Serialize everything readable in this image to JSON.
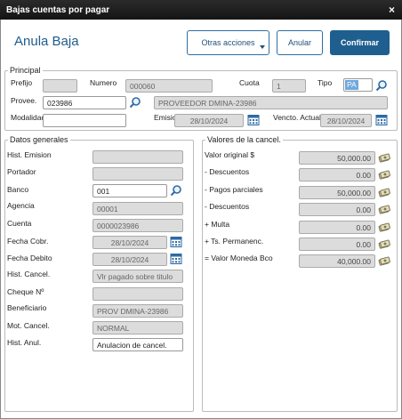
{
  "window": {
    "title": "Bajas cuentas por pagar",
    "close": "×"
  },
  "header": {
    "page_title": "Anula Baja",
    "btn_otras": "Otras acciones",
    "btn_anular": "Anular",
    "btn_confirmar": "Confirmar"
  },
  "principal": {
    "legend": "Principal",
    "prefijo_label": "Prefijo",
    "prefijo_value": "",
    "numero_label": "Numero",
    "numero_value": "000060",
    "cuota_label": "Cuota",
    "cuota_value": "1",
    "tipo_label": "Tipo",
    "tipo_value": "PA",
    "proveedor_label": "Provee.",
    "proveedor_code": "023986",
    "proveedor_name": "PROVEEDOR DMINA-23986",
    "modalidad_label": "Modalidad",
    "modalidad_value": "",
    "emision_label": "Emision",
    "emision_value": "28/10/2024",
    "vencto_label": "Vencto. Actual",
    "vencto_value": "28/10/2024"
  },
  "datos": {
    "legend": "Datos generales",
    "hist_emision_label": "Hist. Emision",
    "hist_emision_value": "",
    "portador_label": "Portador",
    "portador_value": "",
    "banco_label": "Banco",
    "banco_value": "001",
    "agencia_label": "Agencia",
    "agencia_value": "00001",
    "cuenta_label": "Cuenta",
    "cuenta_value": "0000023986",
    "fecha_cobr_label": "Fecha Cobr.",
    "fecha_cobr_value": "28/10/2024",
    "fecha_debito_label": "Fecha Debito",
    "fecha_debito_value": "28/10/2024",
    "hist_cancel_label": "Hist. Cancel.",
    "hist_cancel_value": "Vlr pagado sobre titulo",
    "cheque_label": "Cheque Nº",
    "cheque_value": "",
    "beneficiario_label": "Beneficiario",
    "beneficiario_value": "PROV DMINA-23986",
    "mot_cancel_label": "Mot. Cancel.",
    "mot_cancel_value": "NORMAL",
    "hist_anul_label": "Hist. Anul.",
    "hist_anul_value": "Anulacion de cancel."
  },
  "valores": {
    "legend": "Valores de la cancel.",
    "items": [
      {
        "label": "Valor original $",
        "value": "50,000.00"
      },
      {
        "label": "- Descuentos",
        "value": "0.00"
      },
      {
        "label": "- Pagos parciales",
        "value": "50,000.00"
      },
      {
        "label": "- Descuentos",
        "value": "0.00"
      },
      {
        "label": "+ Multa",
        "value": "0.00"
      },
      {
        "label": "+ Ts. Permanenc.",
        "value": "0.00"
      },
      {
        "label": "= Valor Moneda Bco",
        "value": "40,000.00"
      }
    ]
  },
  "colors": {
    "titlebar": "#1a1a1a",
    "accent": "#1f5f8f",
    "title_text": "#1f5c8c",
    "readonly_field": "#dcdcdc"
  },
  "icons": [
    "close-icon",
    "search-icon",
    "calendar-icon",
    "money-icon",
    "chevron-down-icon"
  ]
}
